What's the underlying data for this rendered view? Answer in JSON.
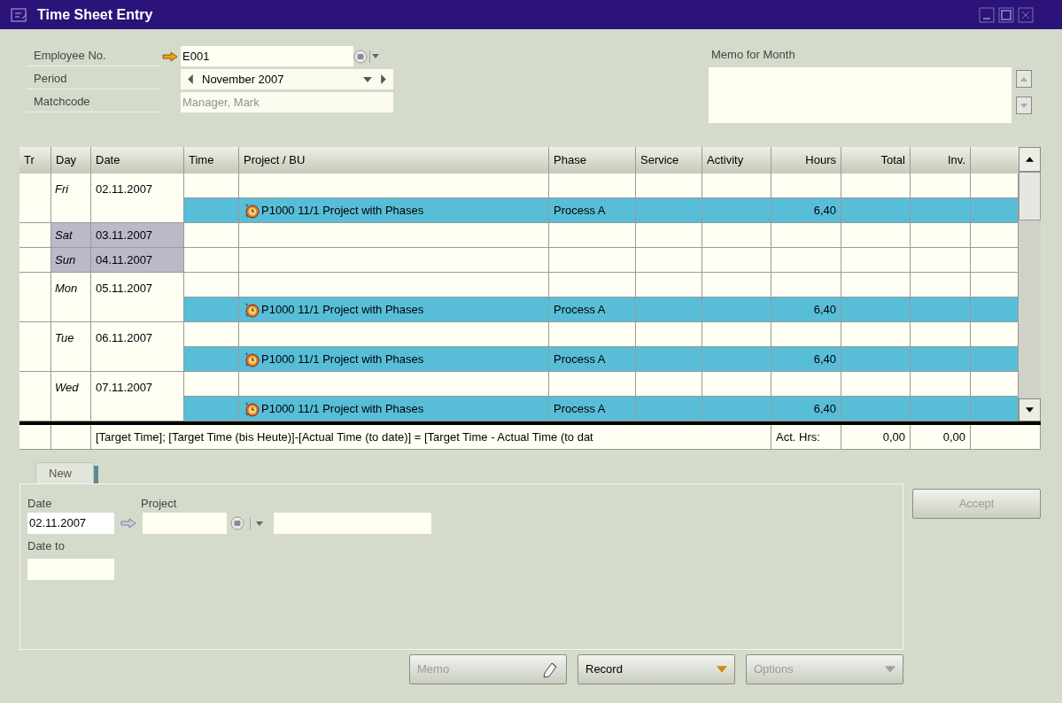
{
  "window": {
    "title": "Time Sheet Entry"
  },
  "header": {
    "fields": [
      {
        "label": "Employee No.",
        "value": "E001",
        "kind": "lookup",
        "disabled": false
      },
      {
        "label": "Period",
        "value": "November 2007",
        "kind": "period",
        "disabled": false
      },
      {
        "label": "Matchcode",
        "value": "Manager, Mark",
        "kind": "text",
        "disabled": true
      }
    ],
    "memo_label": "Memo for Month"
  },
  "table": {
    "columns": [
      "Tr",
      "Day",
      "Date",
      "Time",
      "Project / BU",
      "Phase",
      "Service",
      "Activity",
      "Hours",
      "Total",
      "Inv."
    ],
    "days": [
      {
        "day": "Fri",
        "date": "02.11.2007",
        "weekend": false,
        "entries": [
          {
            "project": "P1000 11/1 Project with Phases",
            "phase": "Process A",
            "hours": "6,40"
          }
        ]
      },
      {
        "day": "Sat",
        "date": "03.11.2007",
        "weekend": true
      },
      {
        "day": "Sun",
        "date": "04.11.2007",
        "weekend": true
      },
      {
        "day": "Mon",
        "date": "05.11.2007",
        "weekend": false,
        "entries": [
          {
            "project": "P1000 11/1 Project with Phases",
            "phase": "Process A",
            "hours": "6,40"
          }
        ]
      },
      {
        "day": "Tue",
        "date": "06.11.2007",
        "weekend": false,
        "entries": [
          {
            "project": "P1000 11/1 Project with Phases",
            "phase": "Process A",
            "hours": "6,40"
          }
        ]
      },
      {
        "day": "Wed",
        "date": "07.11.2007",
        "weekend": false,
        "entries": [
          {
            "project": "P1000 11/1 Project with Phases",
            "phase": "Process A",
            "hours": "6,40"
          }
        ]
      }
    ],
    "footer": {
      "formula": "[Target Time]; [Target Time (bis Heute)]-[Actual Time (to date)] = [Target Time - Actual Time (to dat",
      "label": "Act. Hrs:",
      "total": "0,00",
      "inv": "0,00"
    }
  },
  "new_entry": {
    "tab": "New",
    "date_label": "Date",
    "date_value": "02.11.2007",
    "project_label": "Project",
    "date_to_label": "Date to"
  },
  "buttons": [
    {
      "label": "Accept",
      "disabled": true,
      "kind": "accept"
    },
    {
      "label": "Memo",
      "disabled": true,
      "kind": "memo"
    },
    {
      "label": "Record",
      "disabled": false,
      "kind": "menu"
    },
    {
      "label": "Options",
      "disabled": true,
      "kind": "menu"
    }
  ]
}
